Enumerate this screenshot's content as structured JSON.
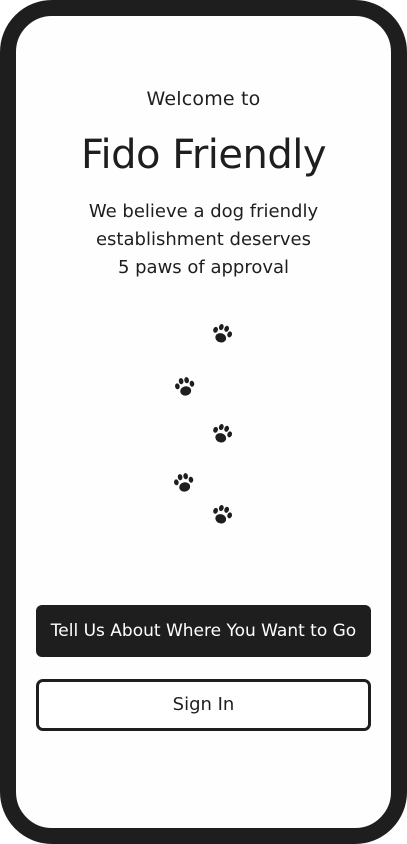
{
  "welcome_text": "Welcome to",
  "app_title": "Fido Friendly",
  "tagline_lines": [
    "We believe a dog friendly",
    "establishment deserves",
    "5 paws of approval"
  ],
  "paw_icon": "paw-print-icon",
  "colors": {
    "frame": "#1e1e1e",
    "background": "#fefefe",
    "primary_button": "#1e1e1e",
    "primary_button_text": "#ffffff"
  },
  "buttons": {
    "primary_label": "Tell Us About Where You Want to Go",
    "secondary_label": "Sign In"
  }
}
